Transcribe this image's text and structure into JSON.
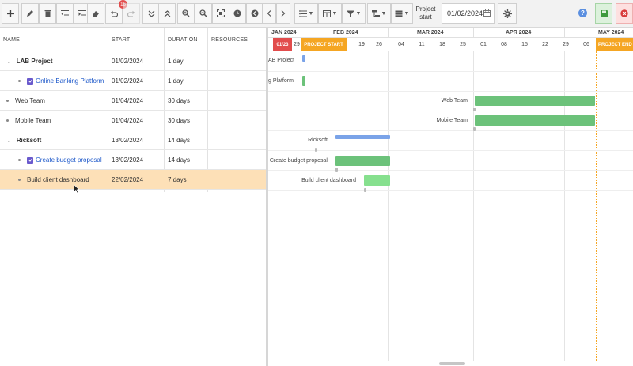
{
  "toolbar": {
    "undo_badge": "16",
    "project_start_label": "Project start",
    "project_start_value": "01/02/2024",
    "help_label": "?"
  },
  "grid": {
    "columns": [
      "NAME",
      "START",
      "DURATION",
      "RESOURCES"
    ],
    "rows": [
      {
        "name": "LAB Project",
        "start": "01/02/2024",
        "duration": "1 day"
      },
      {
        "name": "Online Banking Platform",
        "start": "01/02/2024",
        "duration": "1 day"
      },
      {
        "name": "Web Team",
        "start": "01/04/2024",
        "duration": "30 days"
      },
      {
        "name": "Mobile Team",
        "start": "01/04/2024",
        "duration": "30 days"
      },
      {
        "name": "Ricksoft",
        "start": "13/02/2024",
        "duration": "14 days"
      },
      {
        "name": "Create budget proposal",
        "start": "13/02/2024",
        "duration": "14 days"
      },
      {
        "name": "Build client dashboard",
        "start": "22/02/2024",
        "duration": "7 days"
      }
    ]
  },
  "gantt": {
    "months": [
      "JAN 2024",
      "FEB 2024",
      "MAR 2024",
      "APR 2024",
      "MAY 2024"
    ],
    "days": [
      "29",
      "19",
      "26",
      "04",
      "11",
      "18",
      "25",
      "01",
      "08",
      "15",
      "22",
      "29",
      "06"
    ],
    "today_flag": "01/23",
    "project_start_flag": "PROJECT START",
    "project_end_flag": "PROJECT END",
    "bar_labels": [
      "AB Project",
      "g Platform",
      "Web Team",
      "Mobile Team",
      "Ricksoft",
      "Create budget proposal",
      "Build client dashboard"
    ]
  },
  "colors": {
    "accent_orange": "#f5a623",
    "today_red": "#e24c4c",
    "task_green": "#6cc27a",
    "summary_blue": "#7aa3e8",
    "selected_row": "#fde0b7"
  }
}
